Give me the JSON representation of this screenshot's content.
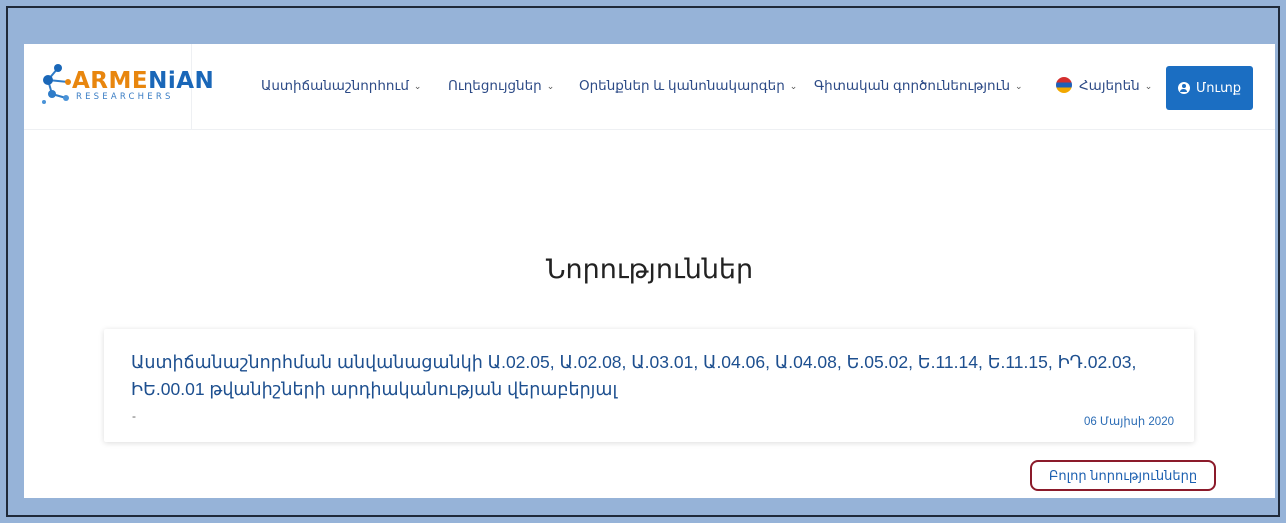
{
  "brand": {
    "logo_text_a": "ARME",
    "logo_text_b": "NiAN",
    "logo_sub": "RESEARCHERS",
    "colors": {
      "orange": "#e8860e",
      "blue": "#1a67b8"
    }
  },
  "nav": {
    "items": [
      {
        "label": "Աստիճանաշնորհում",
        "caret": "⌄"
      },
      {
        "label": "Ուղեցույցներ",
        "caret": "⌄"
      },
      {
        "label": "Օրենքներ և կանոնակարգեր",
        "caret": "⌄"
      },
      {
        "label": "Գիտական գործունեություն",
        "caret": "⌄"
      },
      {
        "label": "Հայերեն",
        "caret": "⌄"
      }
    ],
    "login_label": "Մուտք",
    "login_color": "#1b6ec2"
  },
  "main": {
    "section_title": "Նորություններ",
    "news": [
      {
        "title": "Աստիճանաշնորհման անվանացանկի Ա.02.05, Ա.02.08, Ա.03.01, Ա.04.06, Ա.04.08, Ե.05.02, Ե.11.14, Ե.11.15, ԻԴ.02.03, ԻԵ.00.01 թվանիշների արդիականության վերաբերյալ",
        "excerpt": "-",
        "date": "06 Մայիսի 2020"
      }
    ],
    "all_news_label": "Բոլոր նորությունները"
  }
}
